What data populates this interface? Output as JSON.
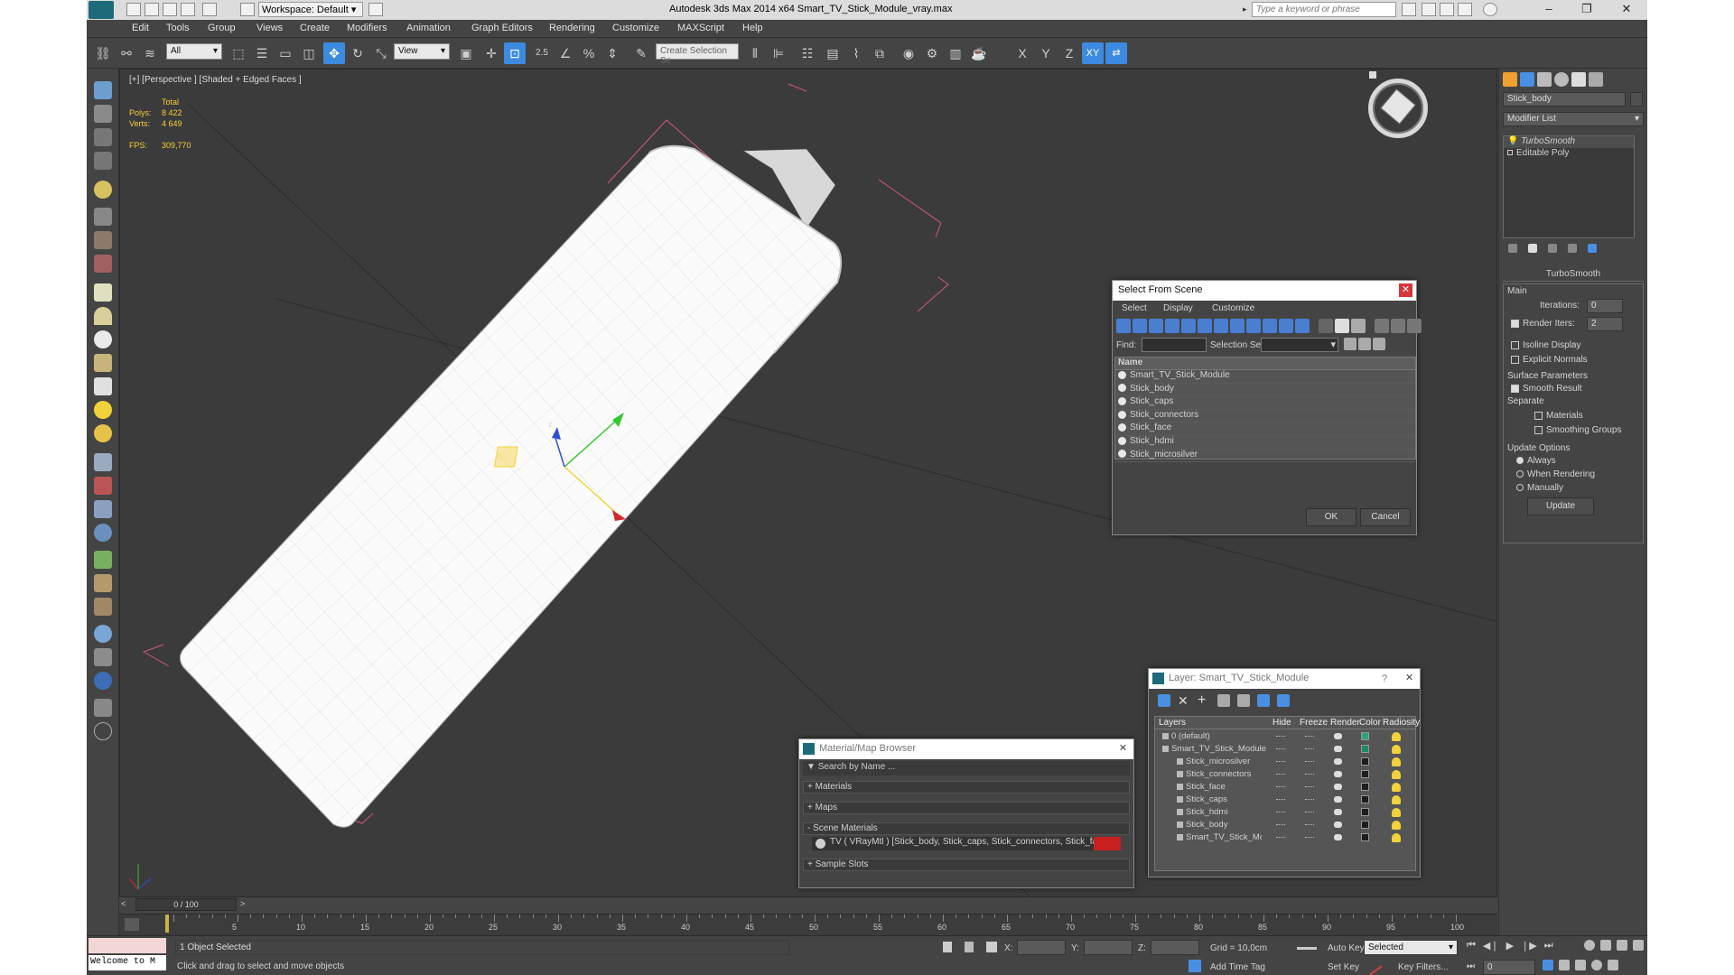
{
  "titlebar": {
    "workspace": "Workspace: Default",
    "title": "Autodesk 3ds Max  2014 x64     Smart_TV_Stick_Module_vray.max",
    "search_placeholder": "Type a keyword or phrase"
  },
  "menu": [
    "Edit",
    "Tools",
    "Group",
    "Views",
    "Create",
    "Modifiers",
    "Animation",
    "Graph Editors",
    "Rendering",
    "Customize",
    "MAXScript",
    "Help"
  ],
  "toolbar": {
    "filter": "All",
    "ref_coord": "View",
    "snap_label": "2.5",
    "selection_set_placeholder": "Create Selection Se",
    "axes": [
      "X",
      "Y",
      "Z",
      "XY"
    ]
  },
  "viewport": {
    "label": "[+] [Perspective ] [Shaded + Edged Faces ]",
    "stats": {
      "header": "Total",
      "polys_label": "Polys:",
      "polys": "8 422",
      "verts_label": "Verts:",
      "verts": "4 649",
      "fps_label": "FPS:",
      "fps": "309,770"
    },
    "gizmo_labels": {
      "z": "z"
    }
  },
  "command_panel": {
    "object_name": "Stick_body",
    "modifier_list": "Modifier List",
    "stack": [
      {
        "name": "TurboSmooth",
        "active": true
      },
      {
        "name": "Editable Poly",
        "active": false
      }
    ],
    "rollout_title": "TurboSmooth",
    "main_label": "Main",
    "iterations_label": "Iterations:",
    "iterations": "0",
    "render_iters_label": "Render Iters:",
    "render_iters": "2",
    "render_iters_checked": true,
    "isoline": "Isoline Display",
    "explicit": "Explicit Normals",
    "surface_params": "Surface Parameters",
    "smooth_result": "Smooth Result",
    "separate": "Separate",
    "materials": "Materials",
    "smoothing_groups": "Smoothing Groups",
    "update_options": "Update Options",
    "always": "Always",
    "when_rendering": "When Rendering",
    "manually": "Manually",
    "update_btn": "Update"
  },
  "select_from_scene": {
    "title": "Select From Scene",
    "menu": [
      "Select",
      "Display",
      "Customize"
    ],
    "find_label": "Find:",
    "selset_label": "Selection Set:",
    "col_name": "Name",
    "items": [
      "Smart_TV_Stick_Module",
      "Stick_body",
      "Stick_caps",
      "Stick_connectors",
      "Stick_face",
      "Stick_hdmi",
      "Stick_microsilver"
    ],
    "ok": "OK",
    "cancel": "Cancel"
  },
  "layer_dialog": {
    "title": "Layer: Smart_TV_Stick_Module",
    "help": "?",
    "cols": [
      "Layers",
      "Hide",
      "Freeze",
      "Render",
      "Color",
      "Radiosity"
    ],
    "rows": [
      {
        "name": "0 (default)",
        "indent": 0,
        "color": "#2aa37f"
      },
      {
        "name": "Smart_TV_Stick_Module",
        "indent": 0,
        "color": "#1f8a63"
      },
      {
        "name": "Stick_microsilver",
        "indent": 1,
        "color": "#1d1d1d"
      },
      {
        "name": "Stick_connectors",
        "indent": 1,
        "color": "#1d1d1d"
      },
      {
        "name": "Stick_face",
        "indent": 1,
        "color": "#1d1d1d"
      },
      {
        "name": "Stick_caps",
        "indent": 1,
        "color": "#1d1d1d"
      },
      {
        "name": "Stick_hdmi",
        "indent": 1,
        "color": "#1d1d1d"
      },
      {
        "name": "Stick_body",
        "indent": 1,
        "color": "#1d1d1d"
      },
      {
        "name": "Smart_TV_Stick_Mod",
        "indent": 1,
        "color": "#1d1d1d"
      }
    ]
  },
  "material_browser": {
    "title": "Material/Map Browser",
    "search_placeholder": "Search by Name ...",
    "groups": [
      "+ Materials",
      "+ Maps",
      "- Scene Materials"
    ],
    "scene_material": "TV  ( VRayMtl ) [Stick_body, Stick_caps, Stick_connectors, Stick_fac...",
    "sample_slots": "+ Sample Slots"
  },
  "timeline": {
    "frame": "0 / 100",
    "ticks": [
      "5",
      "10",
      "15",
      "20",
      "25",
      "30",
      "35",
      "40",
      "45",
      "50",
      "55",
      "60",
      "65",
      "70",
      "75",
      "80",
      "85",
      "90",
      "95",
      "100"
    ]
  },
  "status": {
    "maxscript": "Welcome to M",
    "selected": "1 Object Selected",
    "prompt": "Click and drag to select and move objects",
    "x_label": "X:",
    "y_label": "Y:",
    "z_label": "Z:",
    "grid": "Grid = 10,0cm",
    "add_time_tag": "Add Time Tag",
    "auto_key": "Auto Key",
    "set_key": "Set Key",
    "selected_dd": "Selected",
    "key_filters": "Key Filters...",
    "frame_field": "0"
  },
  "colors": {
    "accent": "#3c8be0",
    "selection_box": "#d05a78",
    "stats": "#f5d03a"
  }
}
